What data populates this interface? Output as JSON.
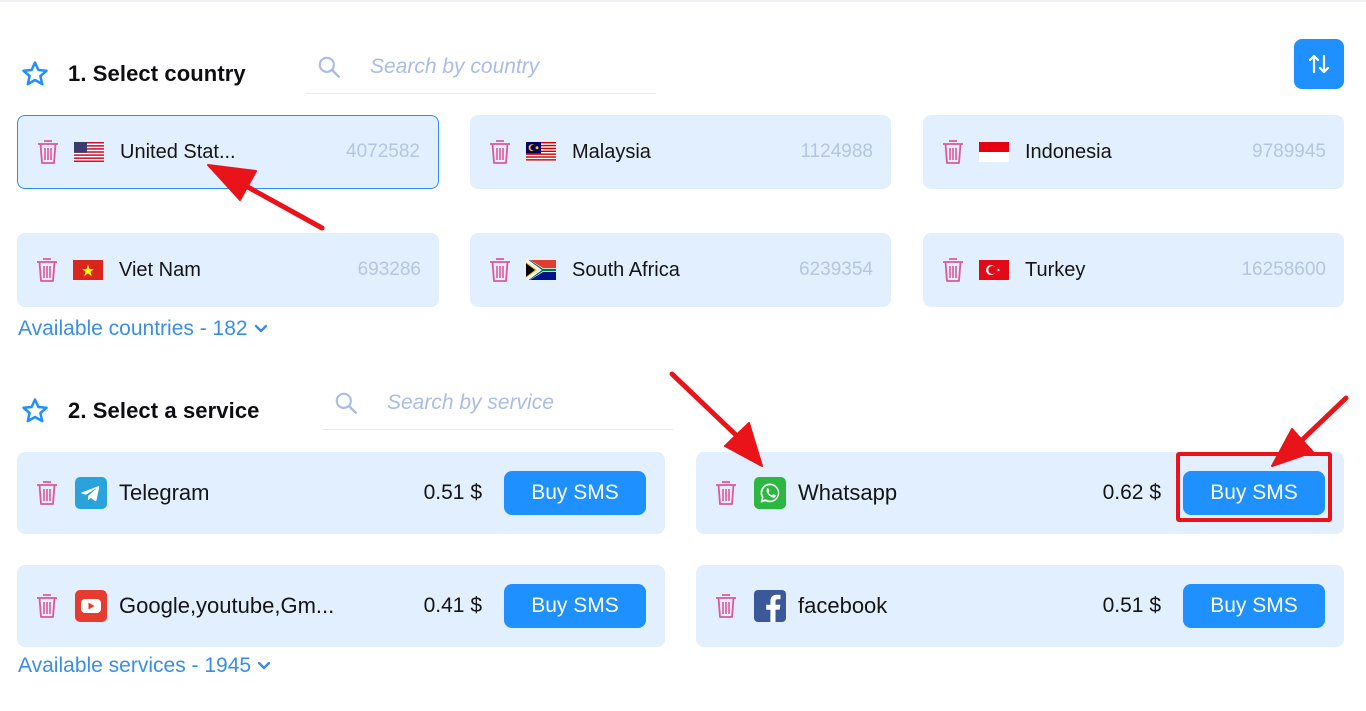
{
  "country_section": {
    "title": "1. Select country",
    "search_placeholder": "Search by country",
    "available": "Available countries - 182"
  },
  "countries": [
    {
      "name": "United Stat...",
      "count": "4072582",
      "flag": "flag-us",
      "selected": true
    },
    {
      "name": "Malaysia",
      "count": "1124988",
      "flag": "flag-my"
    },
    {
      "name": "Indonesia",
      "count": "9789945",
      "flag": "flag-id"
    },
    {
      "name": "Viet Nam",
      "count": "693286",
      "flag": "flag-vn"
    },
    {
      "name": "South Africa",
      "count": "6239354",
      "flag": "flag-za"
    },
    {
      "name": "Turkey",
      "count": "16258600",
      "flag": "flag-tr"
    }
  ],
  "service_section": {
    "title": "2. Select a service",
    "search_placeholder": "Search by service",
    "available": "Available services - 1945"
  },
  "services": [
    {
      "name": "Telegram",
      "price": "0.51 $",
      "buy_label": "Buy SMS",
      "icon": "telegram-icon"
    },
    {
      "name": "Whatsapp",
      "price": "0.62 $",
      "buy_label": "Buy SMS",
      "icon": "whatsapp-icon"
    },
    {
      "name": "Google,youtube,Gm...",
      "price": "0.41 $",
      "buy_label": "Buy SMS",
      "icon": "youtube-icon"
    },
    {
      "name": "facebook",
      "price": "0.51 $",
      "buy_label": "Buy SMS",
      "icon": "facebook-icon"
    }
  ],
  "colors": {
    "accent": "#1e90ff",
    "card_bg": "#e2efff",
    "trash": "#e0589a",
    "link": "#3a8ee6",
    "annotation_red": "#e8141a"
  }
}
